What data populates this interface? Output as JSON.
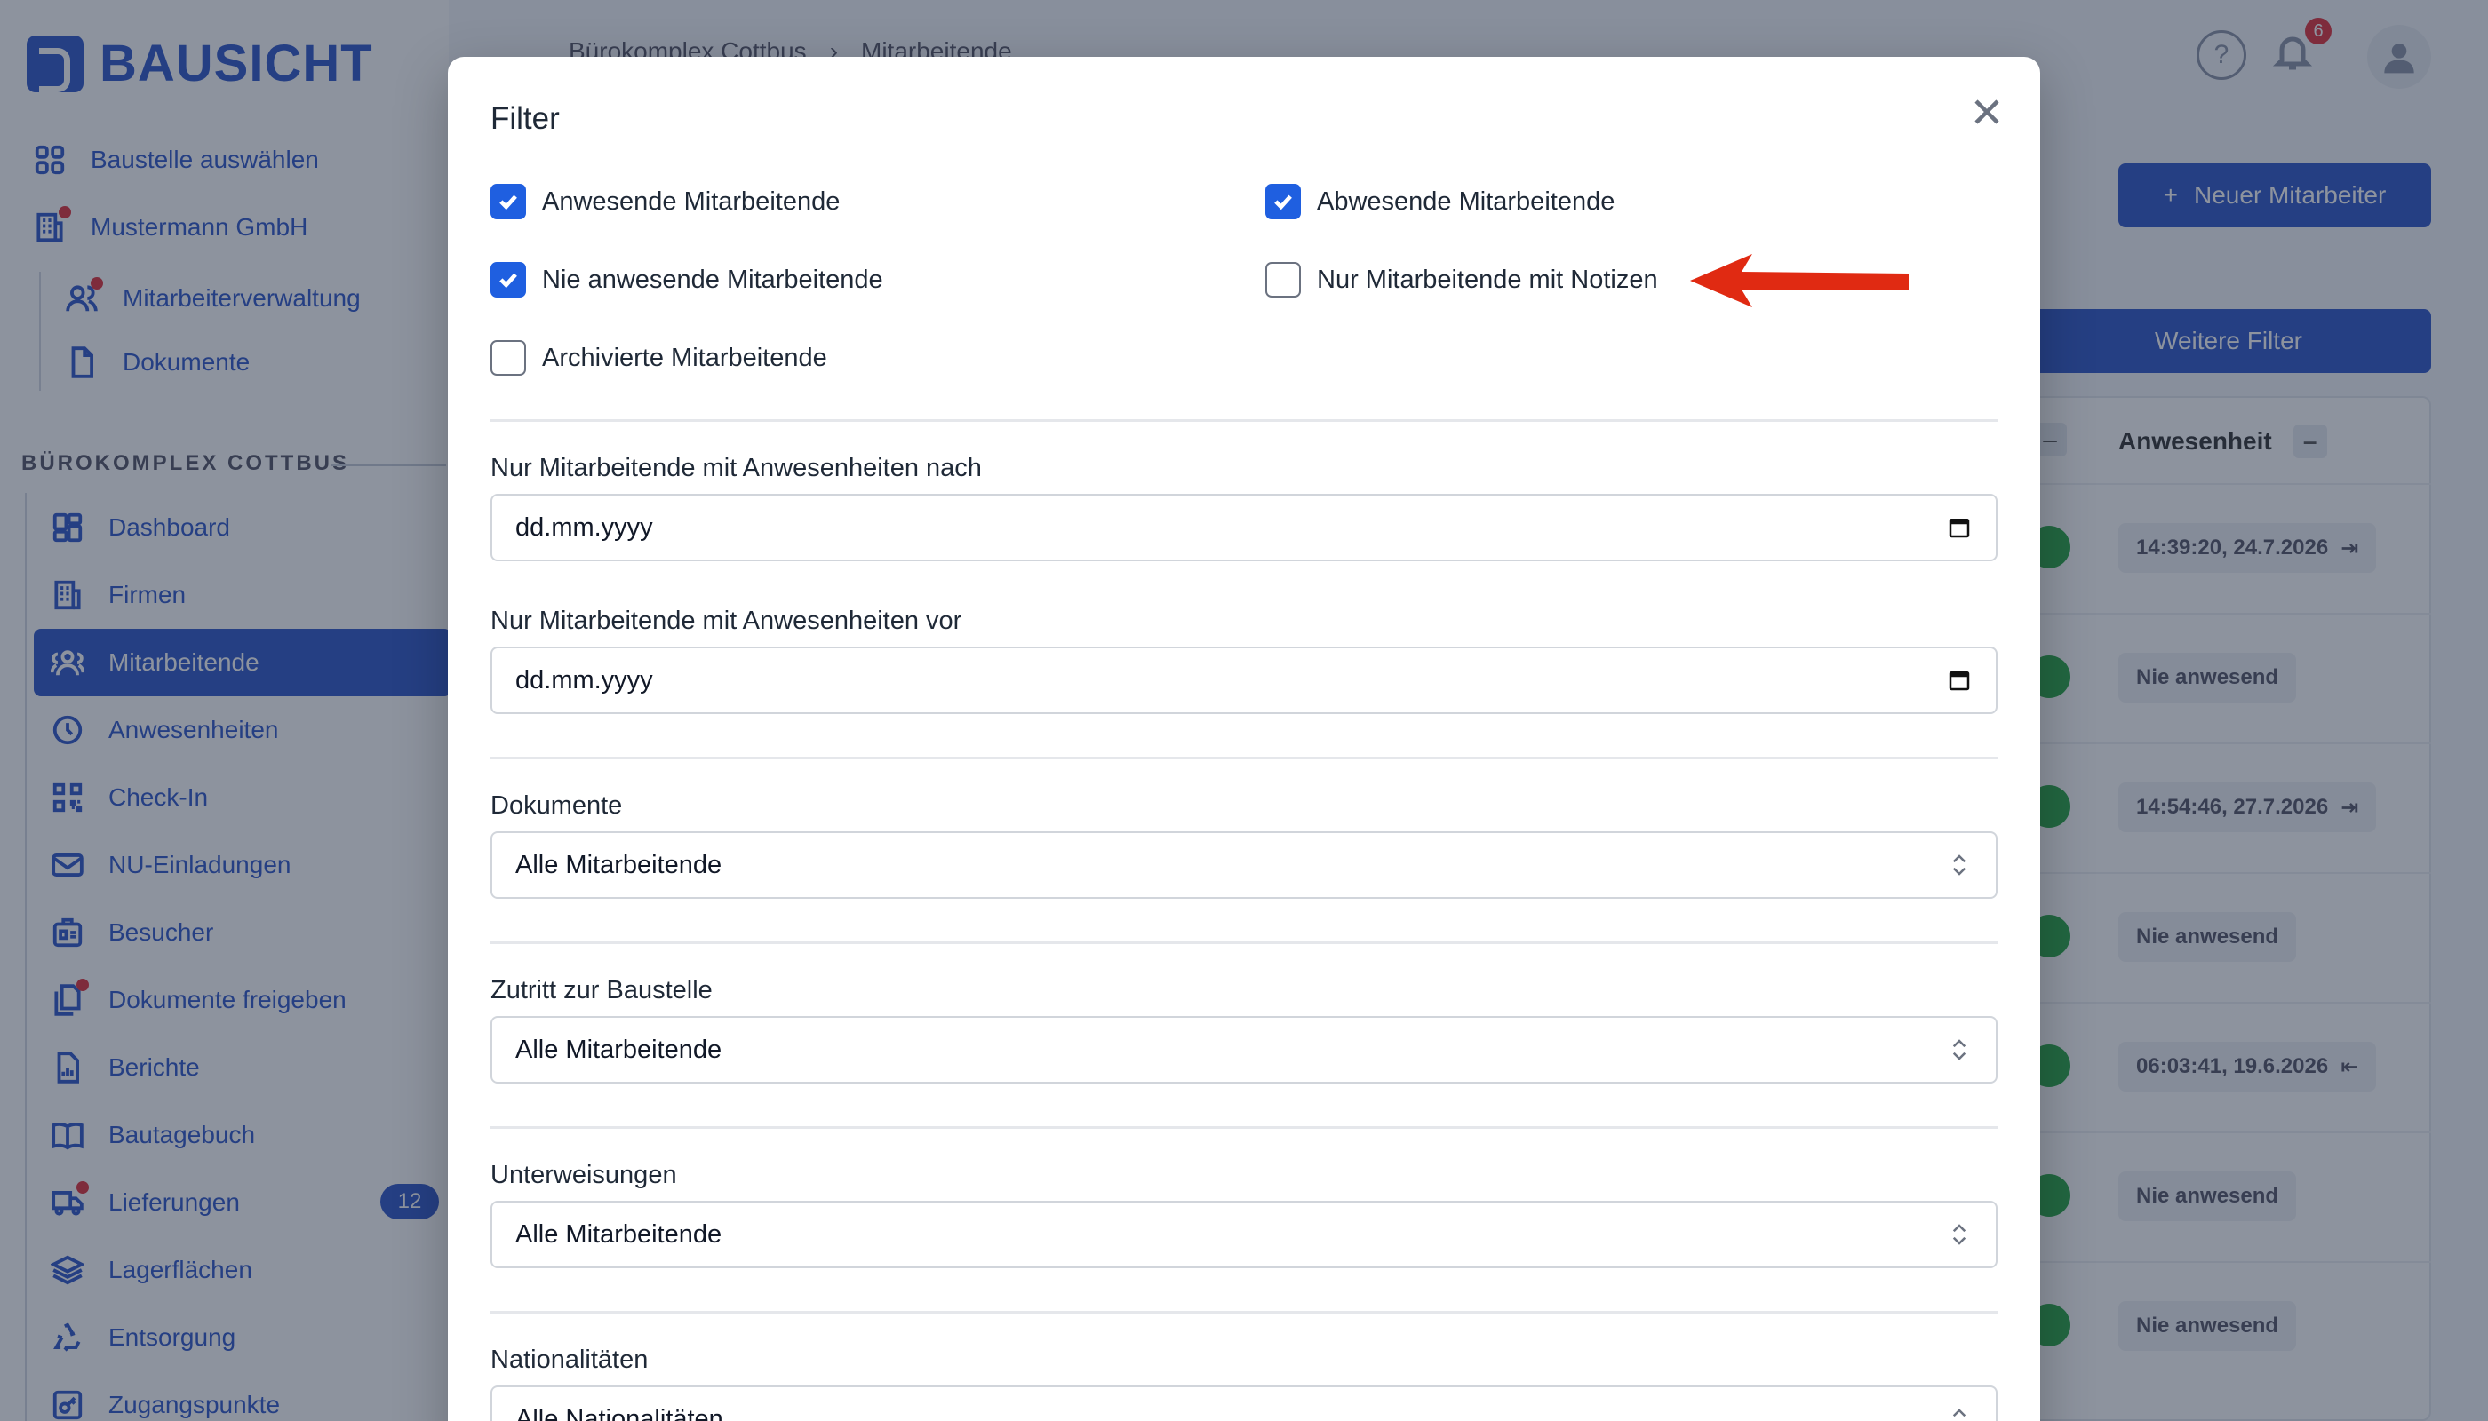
{
  "app": {
    "logo_text": "BAUSICHT",
    "breadcrumb": [
      "Bürokomplex Cottbus",
      "›",
      "Mitarbeitende"
    ],
    "notifications_count": "6",
    "new_employee_label": "Neuer Mitarbeiter",
    "more_filters_label": "Weitere Filter",
    "accent_color": "#2f56c8"
  },
  "sidebar": {
    "top_items": [
      {
        "label": "Baustelle auswählen",
        "icon": "grid-icon"
      },
      {
        "label": "Mustermann GmbH",
        "icon": "building-icon"
      },
      {
        "label": "Mitarbeiterverwaltung",
        "icon": "users-icon"
      },
      {
        "label": "Dokumente",
        "icon": "document-icon"
      }
    ],
    "section_label": "BÜROKOMPLEX COTTBUS",
    "items": [
      {
        "label": "Dashboard",
        "icon": "dashboard-icon"
      },
      {
        "label": "Firmen",
        "icon": "building-icon"
      },
      {
        "label": "Mitarbeitende",
        "icon": "users-icon"
      },
      {
        "label": "Anwesenheiten",
        "icon": "clock-icon"
      },
      {
        "label": "Check-In",
        "icon": "qr-icon"
      },
      {
        "label": "NU-Einladungen",
        "icon": "mail-icon"
      },
      {
        "label": "Besucher",
        "icon": "badge-icon"
      },
      {
        "label": "Dokumente freigeben",
        "icon": "documents-icon"
      },
      {
        "label": "Berichte",
        "icon": "report-icon"
      },
      {
        "label": "Bautagebuch",
        "icon": "book-icon"
      },
      {
        "label": "Lieferungen",
        "icon": "truck-icon",
        "count": "12"
      },
      {
        "label": "Lagerflächen",
        "icon": "layers-icon"
      },
      {
        "label": "Entsorgung",
        "icon": "recycle-icon"
      },
      {
        "label": "Zugangspunkte",
        "icon": "key-icon"
      }
    ]
  },
  "table": {
    "header_presence": "Anwesenheit",
    "rows": [
      "14:39:20, 24.7.2026",
      "Nie anwesend",
      "14:54:46, 27.7.2026",
      "Nie anwesend",
      "06:03:41, 19.6.2026",
      "Nie anwesend",
      "Nie anwesend"
    ]
  },
  "modal": {
    "title": "Filter",
    "checkboxes": [
      {
        "label": "Anwesende Mitarbeitende",
        "checked": true
      },
      {
        "label": "Abwesende Mitarbeitende",
        "checked": true
      },
      {
        "label": "Nie anwesende Mitarbeitende",
        "checked": true
      },
      {
        "label": "Nur Mitarbeitende mit Notizen",
        "checked": false
      },
      {
        "label": "Archivierte Mitarbeitende",
        "checked": false
      }
    ],
    "date_after": {
      "label": "Nur Mitarbeitende mit Anwesenheiten nach",
      "placeholder": "dd.mm.yyyy"
    },
    "date_before": {
      "label": "Nur Mitarbeitende mit Anwesenheiten vor",
      "placeholder": "dd.mm.yyyy"
    },
    "documents": {
      "label": "Dokumente",
      "value": "Alle Mitarbeitende"
    },
    "access": {
      "label": "Zutritt zur Baustelle",
      "value": "Alle Mitarbeitende"
    },
    "instructions": {
      "label": "Unterweisungen",
      "value": "Alle Mitarbeitende"
    },
    "nationalities": {
      "label": "Nationalitäten",
      "value": "Alle Nationalitäten"
    }
  },
  "annotation": {
    "arrow_color": "#e02a12"
  }
}
